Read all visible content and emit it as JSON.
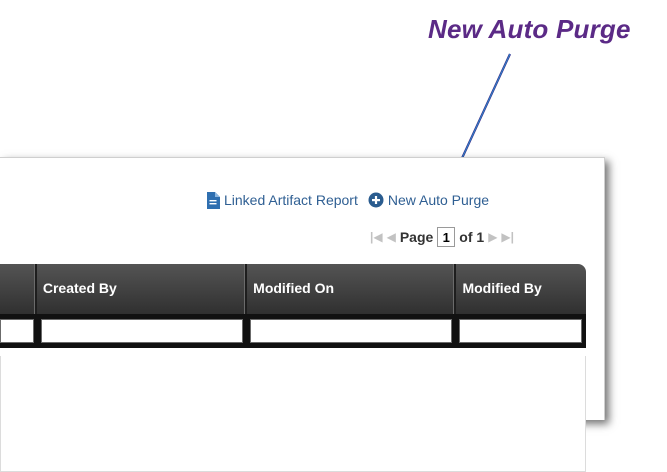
{
  "callout": {
    "title": "New Auto Purge"
  },
  "toolbar": {
    "linked_report_label": "Linked Artifact Report",
    "new_auto_purge_label": "New Auto Purge",
    "icons": [
      "document-icon",
      "plus-circle-icon"
    ],
    "link_color": "#2f5f93"
  },
  "pager": {
    "page_label": "Page",
    "current_page": "1",
    "of_label": "of 1",
    "nav_icons": [
      "first-page-icon",
      "prev-page-icon",
      "next-page-icon",
      "last-page-icon"
    ]
  },
  "grid": {
    "columns": [
      "",
      "Created By",
      "Modified On",
      "Modified By"
    ],
    "header_color": "#3f3f3f"
  },
  "colors": {
    "callout": "#5b2a86",
    "callout_line": "#1a73c9"
  }
}
